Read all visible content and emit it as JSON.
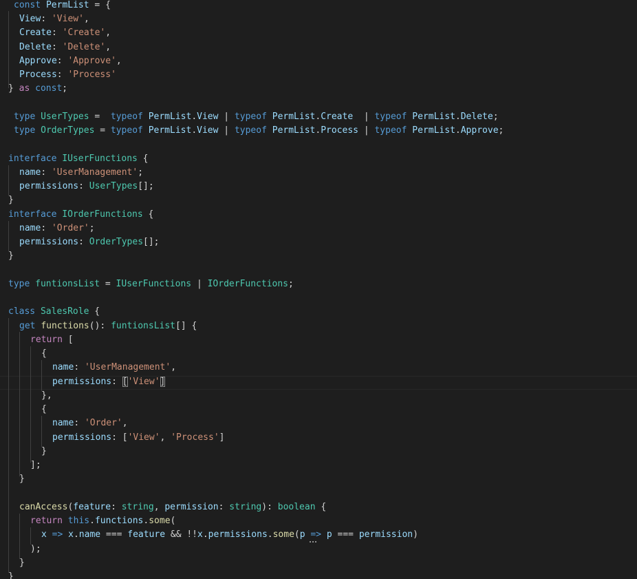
{
  "editor": {
    "theme": "dark",
    "colors": {
      "background": "#1e1e1e",
      "keyword": "#569cd6",
      "control": "#c586c0",
      "type": "#4ec9b0",
      "variable": "#9cdcfe",
      "string": "#ce9178",
      "function": "#dcdcaa",
      "punctuation": "#d4d4d4"
    },
    "lines": [
      {
        "tokens": [
          {
            "t": "const",
            "c": "kw"
          },
          {
            "t": " "
          },
          {
            "t": "PermList",
            "c": "var"
          },
          {
            "t": " = {"
          }
        ]
      },
      {
        "tokens": [
          {
            "t": "View",
            "c": "var"
          },
          {
            "t": ": "
          },
          {
            "t": "'View'",
            "c": "str"
          },
          {
            "t": ","
          }
        ]
      },
      {
        "tokens": [
          {
            "t": "Create",
            "c": "var"
          },
          {
            "t": ": "
          },
          {
            "t": "'Create'",
            "c": "str"
          },
          {
            "t": ","
          }
        ]
      },
      {
        "tokens": [
          {
            "t": "Delete",
            "c": "var"
          },
          {
            "t": ": "
          },
          {
            "t": "'Delete'",
            "c": "str"
          },
          {
            "t": ","
          }
        ]
      },
      {
        "tokens": [
          {
            "t": "Approve",
            "c": "var"
          },
          {
            "t": ": "
          },
          {
            "t": "'Approve'",
            "c": "str"
          },
          {
            "t": ","
          }
        ]
      },
      {
        "tokens": [
          {
            "t": "Process",
            "c": "var"
          },
          {
            "t": ": "
          },
          {
            "t": "'Process'",
            "c": "str"
          }
        ]
      },
      {
        "tokens": [
          {
            "t": "} "
          },
          {
            "t": "as",
            "c": "ctl"
          },
          {
            "t": " "
          },
          {
            "t": "const",
            "c": "kw"
          },
          {
            "t": ";"
          }
        ]
      },
      {
        "tokens": []
      },
      {
        "tokens": [
          {
            "t": "type",
            "c": "kw"
          },
          {
            "t": " "
          },
          {
            "t": "UserTypes",
            "c": "ty"
          },
          {
            "t": " =  "
          },
          {
            "t": "typeof",
            "c": "kw"
          },
          {
            "t": " "
          },
          {
            "t": "PermList",
            "c": "var"
          },
          {
            "t": "."
          },
          {
            "t": "View",
            "c": "var"
          },
          {
            "t": " | "
          },
          {
            "t": "typeof",
            "c": "kw"
          },
          {
            "t": " "
          },
          {
            "t": "PermList",
            "c": "var"
          },
          {
            "t": "."
          },
          {
            "t": "Create",
            "c": "var"
          },
          {
            "t": "  | "
          },
          {
            "t": "typeof",
            "c": "kw"
          },
          {
            "t": " "
          },
          {
            "t": "PermList",
            "c": "var"
          },
          {
            "t": "."
          },
          {
            "t": "Delete",
            "c": "var"
          },
          {
            "t": ";"
          }
        ]
      },
      {
        "tokens": [
          {
            "t": "type",
            "c": "kw"
          },
          {
            "t": " "
          },
          {
            "t": "OrderTypes",
            "c": "ty"
          },
          {
            "t": " = "
          },
          {
            "t": "typeof",
            "c": "kw"
          },
          {
            "t": " "
          },
          {
            "t": "PermList",
            "c": "var"
          },
          {
            "t": "."
          },
          {
            "t": "View",
            "c": "var"
          },
          {
            "t": " | "
          },
          {
            "t": "typeof",
            "c": "kw"
          },
          {
            "t": " "
          },
          {
            "t": "PermList",
            "c": "var"
          },
          {
            "t": "."
          },
          {
            "t": "Process",
            "c": "var"
          },
          {
            "t": " | "
          },
          {
            "t": "typeof",
            "c": "kw"
          },
          {
            "t": " "
          },
          {
            "t": "PermList",
            "c": "var"
          },
          {
            "t": "."
          },
          {
            "t": "Approve",
            "c": "var"
          },
          {
            "t": ";"
          }
        ]
      },
      {
        "tokens": []
      },
      {
        "tokens": [
          {
            "t": "interface",
            "c": "kw"
          },
          {
            "t": " "
          },
          {
            "t": "IUserFunctions",
            "c": "ty"
          },
          {
            "t": " {"
          }
        ]
      },
      {
        "tokens": [
          {
            "t": "name",
            "c": "var"
          },
          {
            "t": ": "
          },
          {
            "t": "'UserManagement'",
            "c": "str"
          },
          {
            "t": ";"
          }
        ]
      },
      {
        "tokens": [
          {
            "t": "permissions",
            "c": "var"
          },
          {
            "t": ": "
          },
          {
            "t": "UserTypes",
            "c": "ty"
          },
          {
            "t": "[];"
          }
        ]
      },
      {
        "tokens": [
          {
            "t": "}"
          }
        ]
      },
      {
        "tokens": [
          {
            "t": "interface",
            "c": "kw"
          },
          {
            "t": " "
          },
          {
            "t": "IOrderFunctions",
            "c": "ty"
          },
          {
            "t": " {"
          }
        ]
      },
      {
        "tokens": [
          {
            "t": "name",
            "c": "var"
          },
          {
            "t": ": "
          },
          {
            "t": "'Order'",
            "c": "str"
          },
          {
            "t": ";"
          }
        ]
      },
      {
        "tokens": [
          {
            "t": "permissions",
            "c": "var"
          },
          {
            "t": ": "
          },
          {
            "t": "OrderTypes",
            "c": "ty"
          },
          {
            "t": "[];"
          }
        ]
      },
      {
        "tokens": [
          {
            "t": "}"
          }
        ]
      },
      {
        "tokens": []
      },
      {
        "tokens": [
          {
            "t": "type",
            "c": "kw"
          },
          {
            "t": " "
          },
          {
            "t": "funtionsList",
            "c": "ty"
          },
          {
            "t": " = "
          },
          {
            "t": "IUserFunctions",
            "c": "ty"
          },
          {
            "t": " | "
          },
          {
            "t": "IOrderFunctions",
            "c": "ty"
          },
          {
            "t": ";"
          }
        ]
      },
      {
        "tokens": []
      },
      {
        "tokens": [
          {
            "t": "class",
            "c": "kw"
          },
          {
            "t": " "
          },
          {
            "t": "SalesRole",
            "c": "ty"
          },
          {
            "t": " {"
          }
        ]
      },
      {
        "tokens": [
          {
            "t": "get",
            "c": "kw"
          },
          {
            "t": " "
          },
          {
            "t": "functions",
            "c": "fn"
          },
          {
            "t": "(): "
          },
          {
            "t": "funtionsList",
            "c": "ty"
          },
          {
            "t": "[] {"
          }
        ]
      },
      {
        "tokens": [
          {
            "t": "return",
            "c": "ctl"
          },
          {
            "t": " ["
          }
        ]
      },
      {
        "tokens": [
          {
            "t": "{"
          }
        ]
      },
      {
        "tokens": [
          {
            "t": "name",
            "c": "var"
          },
          {
            "t": ": "
          },
          {
            "t": "'UserManagement'",
            "c": "str"
          },
          {
            "t": ","
          }
        ]
      },
      {
        "tokens": [
          {
            "t": "permissions",
            "c": "var"
          },
          {
            "t": ": "
          },
          {
            "t": "[",
            "c": "brk-match"
          },
          {
            "t": "'View'",
            "c": "str"
          },
          {
            "t": "]",
            "c": "brk-match"
          }
        ]
      },
      {
        "tokens": [
          {
            "t": "},"
          }
        ]
      },
      {
        "tokens": [
          {
            "t": "{"
          }
        ]
      },
      {
        "tokens": [
          {
            "t": "name",
            "c": "var"
          },
          {
            "t": ": "
          },
          {
            "t": "'Order'",
            "c": "str"
          },
          {
            "t": ","
          }
        ]
      },
      {
        "tokens": [
          {
            "t": "permissions",
            "c": "var"
          },
          {
            "t": ": ["
          },
          {
            "t": "'View'",
            "c": "str"
          },
          {
            "t": ", "
          },
          {
            "t": "'Process'",
            "c": "str"
          },
          {
            "t": "]"
          }
        ]
      },
      {
        "tokens": [
          {
            "t": "}"
          }
        ]
      },
      {
        "tokens": [
          {
            "t": "];"
          }
        ]
      },
      {
        "tokens": [
          {
            "t": "}"
          }
        ]
      },
      {
        "tokens": []
      },
      {
        "tokens": [
          {
            "t": "canAccess",
            "c": "fn"
          },
          {
            "t": "("
          },
          {
            "t": "feature",
            "c": "var"
          },
          {
            "t": ": "
          },
          {
            "t": "string",
            "c": "ty"
          },
          {
            "t": ", "
          },
          {
            "t": "permission",
            "c": "var"
          },
          {
            "t": ": "
          },
          {
            "t": "string",
            "c": "ty"
          },
          {
            "t": "): "
          },
          {
            "t": "boolean",
            "c": "ty"
          },
          {
            "t": " {"
          }
        ]
      },
      {
        "tokens": [
          {
            "t": "return",
            "c": "ctl"
          },
          {
            "t": " "
          },
          {
            "t": "this",
            "c": "kw"
          },
          {
            "t": "."
          },
          {
            "t": "functions",
            "c": "var"
          },
          {
            "t": "."
          },
          {
            "t": "some",
            "c": "fn"
          },
          {
            "t": "("
          }
        ]
      },
      {
        "tokens": [
          {
            "t": "x",
            "c": "var"
          },
          {
            "t": " "
          },
          {
            "t": "=>",
            "c": "kw"
          },
          {
            "t": " "
          },
          {
            "t": "x",
            "c": "var"
          },
          {
            "t": "."
          },
          {
            "t": "name",
            "c": "var"
          },
          {
            "t": " === "
          },
          {
            "t": "feature",
            "c": "var"
          },
          {
            "t": " && !!"
          },
          {
            "t": "x",
            "c": "var"
          },
          {
            "t": "."
          },
          {
            "t": "permissions",
            "c": "var"
          },
          {
            "t": "."
          },
          {
            "t": "some",
            "c": "fn"
          },
          {
            "t": "("
          },
          {
            "t": "p",
            "c": "var"
          },
          {
            "t": " "
          },
          {
            "t": "=>",
            "c": "kw"
          },
          {
            "t": " "
          },
          {
            "t": "p",
            "c": "var"
          },
          {
            "t": " === "
          },
          {
            "t": "permission",
            "c": "var"
          },
          {
            "t": ")"
          }
        ]
      },
      {
        "tokens": [
          {
            "t": ");"
          }
        ]
      },
      {
        "tokens": [
          {
            "t": "}"
          }
        ]
      },
      {
        "tokens": [
          {
            "t": "}"
          }
        ]
      }
    ]
  }
}
